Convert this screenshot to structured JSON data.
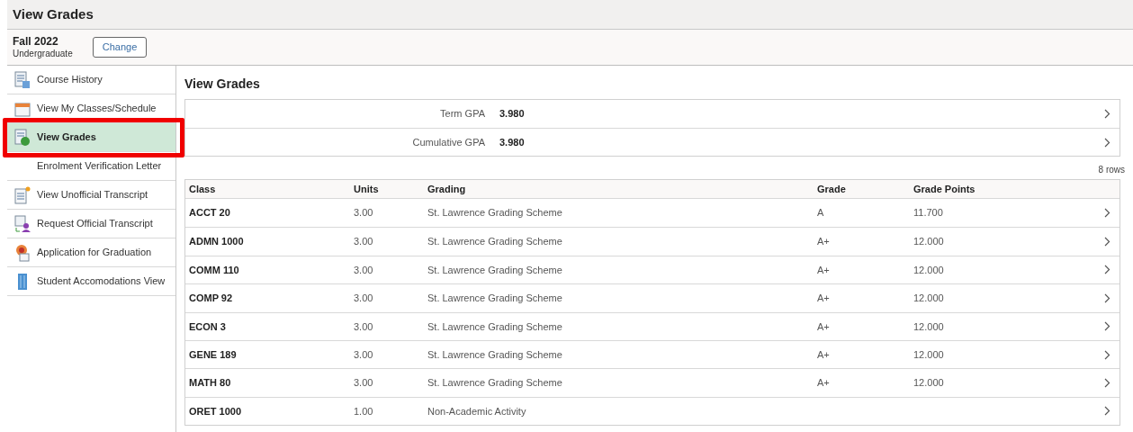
{
  "header": {
    "title": "View Grades"
  },
  "term": {
    "name": "Fall 2022",
    "career": "Undergraduate",
    "button": "Change"
  },
  "sidebar": {
    "items": [
      {
        "label": "Course History",
        "selected": false,
        "annotated": false
      },
      {
        "label": "View My Classes/Schedule",
        "selected": false,
        "annotated": false
      },
      {
        "label": "View Grades",
        "selected": true,
        "annotated": true
      },
      {
        "label": "Enrolment Verification Letter",
        "selected": false,
        "annotated": false
      },
      {
        "label": "View Unofficial Transcript",
        "selected": false,
        "annotated": false
      },
      {
        "label": "Request Official Transcript",
        "selected": false,
        "annotated": false
      },
      {
        "label": "Application for Graduation",
        "selected": false,
        "annotated": false
      },
      {
        "label": "Student Accomodations View",
        "selected": false,
        "annotated": false
      }
    ]
  },
  "main": {
    "heading": "View Grades",
    "gpa": [
      {
        "label": "Term GPA",
        "value": "3.980"
      },
      {
        "label": "Cumulative GPA",
        "value": "3.980"
      }
    ],
    "row_count": "8 rows",
    "table": {
      "columns": [
        "Class",
        "Units",
        "Grading",
        "Grade",
        "Grade Points"
      ],
      "rows": [
        [
          "ACCT 20",
          "3.00",
          "St. Lawrence Grading Scheme",
          "A",
          "11.700"
        ],
        [
          "ADMN 1000",
          "3.00",
          "St. Lawrence Grading Scheme",
          "A+",
          "12.000"
        ],
        [
          "COMM 110",
          "3.00",
          "St. Lawrence Grading Scheme",
          "A+",
          "12.000"
        ],
        [
          "COMP 92",
          "3.00",
          "St. Lawrence Grading Scheme",
          "A+",
          "12.000"
        ],
        [
          "ECON 3",
          "3.00",
          "St. Lawrence Grading Scheme",
          "A+",
          "12.000"
        ],
        [
          "GENE 189",
          "3.00",
          "St. Lawrence Grading Scheme",
          "A+",
          "12.000"
        ],
        [
          "MATH 80",
          "3.00",
          "St. Lawrence Grading Scheme",
          "A+",
          "12.000"
        ],
        [
          "ORET 1000",
          "1.00",
          "Non-Academic Activity",
          "",
          ""
        ]
      ]
    }
  }
}
